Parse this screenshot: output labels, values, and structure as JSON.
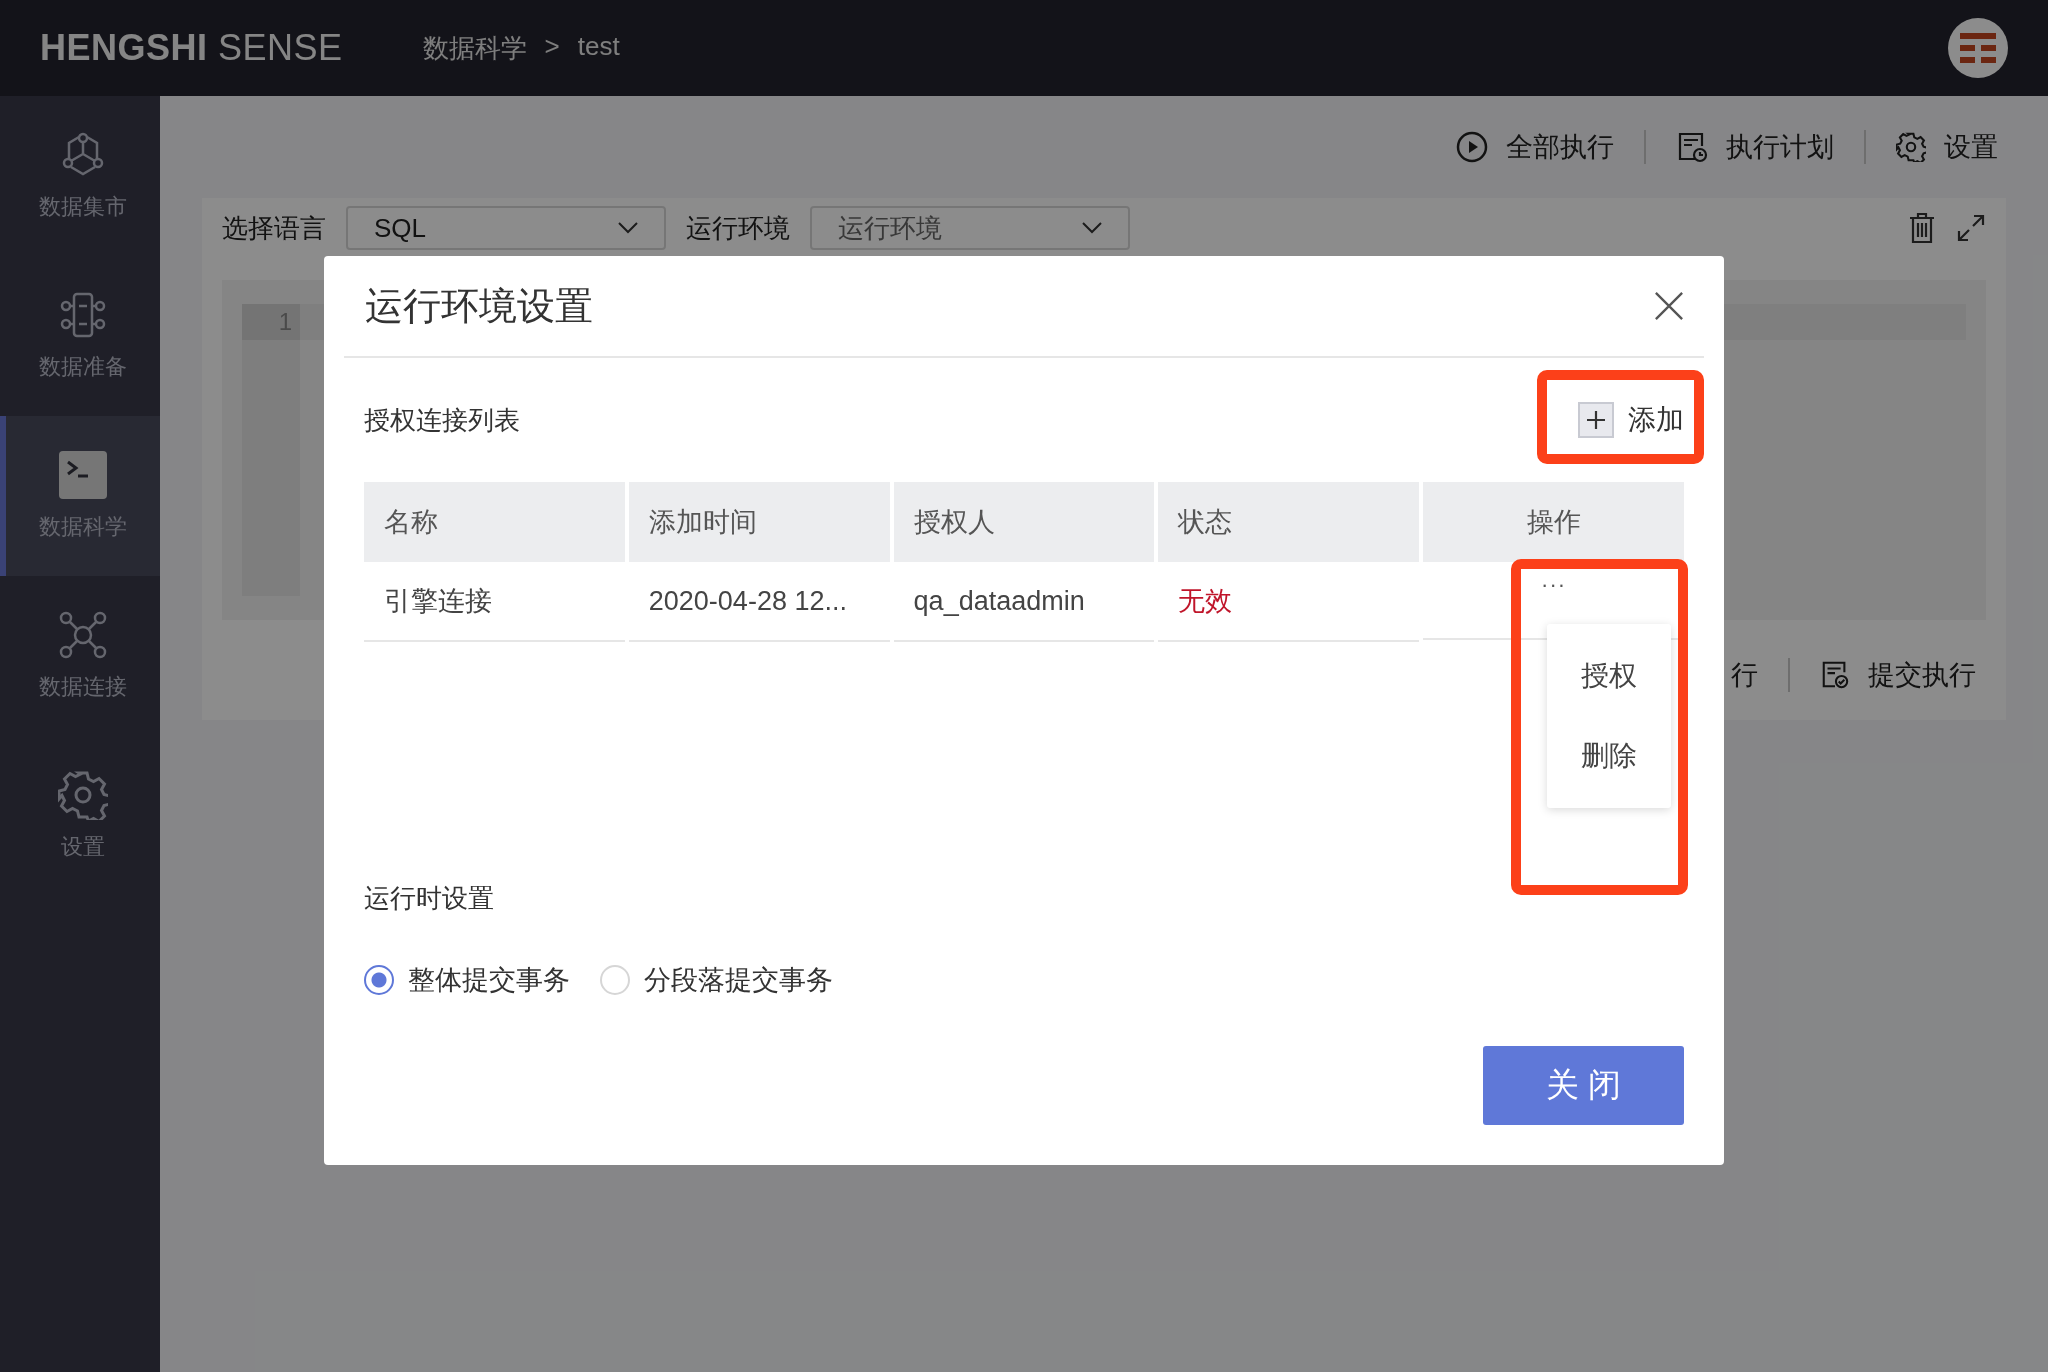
{
  "header": {
    "logo_bold": "HENGSHI",
    "logo_light": "SENSE",
    "breadcrumb": [
      "数据科学",
      "test"
    ],
    "breadcrumb_separator": ">"
  },
  "sidebar": {
    "items": [
      {
        "label": "数据集市",
        "selected": false
      },
      {
        "label": "数据准备",
        "selected": false
      },
      {
        "label": "数据科学",
        "selected": true
      },
      {
        "label": "数据连接",
        "selected": false
      },
      {
        "label": "设置",
        "selected": false
      }
    ]
  },
  "toolbar": [
    "全部执行",
    "执行计划",
    "设置"
  ],
  "editor": {
    "language_label": "选择语言",
    "language_value": "SQL",
    "environment_label": "运行环境",
    "environment_placeholder": "运行环境",
    "line_numbers": [
      "1"
    ],
    "actions": [
      "行",
      "提交执行"
    ]
  },
  "dialog": {
    "title": "运行环境设置",
    "section_title": "授权连接列表",
    "add_button": "添加",
    "table": {
      "columns": [
        "名称",
        "添加时间",
        "授权人",
        "状态",
        "操作"
      ],
      "rows": [
        {
          "cells": [
            "引擎连接",
            "2020-04-28 12...",
            "qa_dataadmin",
            "无效"
          ],
          "color": "#c0152a",
          "more": "···"
        }
      ]
    },
    "row_menu": [
      "授权",
      "删除"
    ],
    "runtime_title": "运行时设置",
    "runtime_options": [
      {
        "label": "整体提交事务",
        "selected": true
      },
      {
        "label": "分段落提交事务",
        "selected": false
      }
    ],
    "close_button": "关 闭"
  }
}
